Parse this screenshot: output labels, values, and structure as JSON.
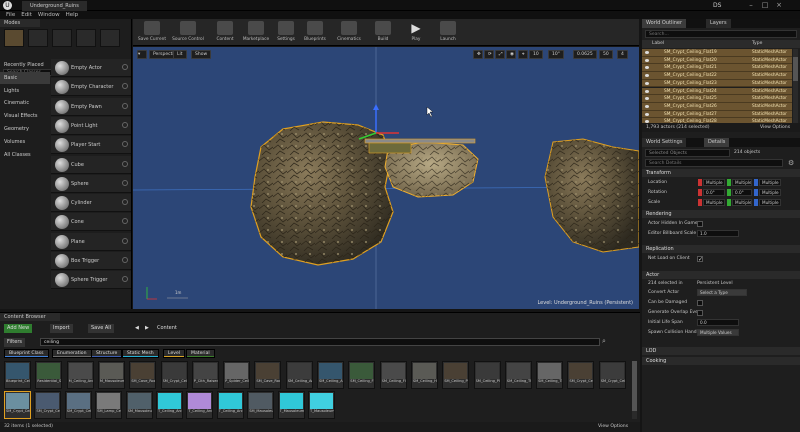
{
  "window": {
    "title": "Underground_Ruins",
    "user": "DS"
  },
  "menu": [
    "File",
    "Edit",
    "Window",
    "Help"
  ],
  "modes": {
    "tab": "Modes",
    "search_placeholder": "Search Classes",
    "categories": [
      "Recently Placed",
      "Basic",
      "Lights",
      "Cinematic",
      "Visual Effects",
      "Geometry",
      "Volumes",
      "All Classes"
    ],
    "selected_category": "Basic",
    "items": [
      "Empty Actor",
      "Empty Character",
      "Empty Pawn",
      "Point Light",
      "Player Start",
      "Cube",
      "Sphere",
      "Cylinder",
      "Cone",
      "Plane",
      "Box Trigger",
      "Sphere Trigger"
    ]
  },
  "toolbar": [
    "Save Current",
    "Source Control",
    "Content",
    "Marketplace",
    "Settings",
    "Blueprints",
    "Cinematics",
    "Build",
    "Play",
    "Launch"
  ],
  "viewport": {
    "perspective": "Perspective",
    "lit": "Lit",
    "show": "Show",
    "snap_grid": "10",
    "snap_angle": "10°",
    "snap_scale": "0.0625",
    "camera_speed": "50",
    "layers": "4",
    "scale_label": "1m",
    "level_info": "Level:  Underground_Ruins (Persistent)"
  },
  "outliner": {
    "tabs": [
      "World Outliner",
      "Layers"
    ],
    "search_placeholder": "Search...",
    "col_label": "Label",
    "col_type": "Type",
    "rows": [
      {
        "name": "SM_Crypt_Ceiling_Flat19",
        "type": "StaticMeshActor"
      },
      {
        "name": "SM_Crypt_Ceiling_Flat20",
        "type": "StaticMeshActor"
      },
      {
        "name": "SM_Crypt_Ceiling_Flat21",
        "type": "StaticMeshActor"
      },
      {
        "name": "SM_Crypt_Ceiling_Flat22",
        "type": "StaticMeshActor"
      },
      {
        "name": "SM_Crypt_Ceiling_Flat23",
        "type": "StaticMeshActor"
      },
      {
        "name": "SM_Crypt_Ceiling_Flat24",
        "type": "StaticMeshActor"
      },
      {
        "name": "SM_Crypt_Ceiling_Flat25",
        "type": "StaticMeshActor"
      },
      {
        "name": "SM_Crypt_Ceiling_Flat26",
        "type": "StaticMeshActor"
      },
      {
        "name": "SM_Crypt_Ceiling_Flat27",
        "type": "StaticMeshActor"
      },
      {
        "name": "SM_Crypt_Ceiling_Flat28",
        "type": "StaticMeshActor"
      }
    ],
    "count": "1,793 actors (214 selected)",
    "view_options": "View Options"
  },
  "details": {
    "tabs": [
      "World Settings",
      "Details"
    ],
    "selected_objects": "Selected Objects",
    "object_count": "214 objects",
    "search_placeholder": "Search Details",
    "transform": {
      "title": "Transform",
      "location": "Location",
      "rotation": "Rotation",
      "scale": "Scale",
      "multiple": "Multiple",
      "zero": "0.0°"
    },
    "rendering": {
      "title": "Rendering",
      "hidden": "Actor Hidden In Game",
      "billboard": "Editor Billboard Scale",
      "billboard_value": "1.0"
    },
    "replication": {
      "title": "Replication",
      "net_load": "Net Load on Client"
    },
    "actor": {
      "title": "Actor",
      "selected_in": "214 selected in",
      "persistent": "Persistent Level",
      "convert": "Convert Actor",
      "convert_value": "Select a Type",
      "can_damage": "Can be Damaged",
      "overlap": "Generate Overlap Eve",
      "lifespan": "Initial Life Span",
      "lifespan_value": "0.0",
      "spawn": "Spawn Collision Hand",
      "spawn_value": "Multiple Values"
    },
    "lod": "LOD",
    "cooking": "Cooking"
  },
  "content": {
    "tab": "Content Browser",
    "add_new": "Add New",
    "import": "Import",
    "save_all": "Save All",
    "path": "Content",
    "filters": "Filters",
    "search_value": "ceiling",
    "filter_chips": [
      {
        "label": "Blueprint Class",
        "color": "#3f7fd8"
      },
      {
        "label": "Enumeration",
        "color": "#6b6b6b"
      },
      {
        "label": "Structure",
        "color": "#3d5fb0"
      },
      {
        "label": "Static Mesh",
        "color": "#26b0d4"
      },
      {
        "label": "Level",
        "color": "#d8a325"
      },
      {
        "label": "Material",
        "color": "#3a7d2a"
      }
    ],
    "assets_row1": [
      "Blueprint_Ceiling_Lines",
      "Residential_Spider_Ceiling",
      "M_Ceiling_Arch_Sub",
      "M_Mausoleum_Ceiling",
      "SM_Cave_Rock_Ceiling_Dim",
      "SM_Crypt_Ceiling_Blank",
      "P_Clth_Raised_Ceiling_Drip",
      "P_Spider_Ceiling_Drip",
      "SM_Cave_Rock_Ceiling_Wide",
      "SM_Ceiling_Arch_A",
      "SM_Ceiling_Arch_E",
      "SM_Ceiling_Flat",
      "SM_Ceiling_Flat_Half",
      "SM_Ceiling_Half",
      "SM_Ceiling_Plaza",
      "SM_Ceiling_Plaza_B",
      "SM_Ceiling_Third",
      "SM_Ceiling_Third_Reverse",
      "SM_Crypt_Ceiling",
      "SM_Crypt_Ceiling_Flat"
    ],
    "assets_row2": [
      "SM_Crypt_Ceiling_Flat_Half",
      "SM_Crypt_Ceiling_Half",
      "SM_Crypt_Ceiling_Half_Arch",
      "SM_Lamp_Ceiling_Iron",
      "SM_Mausoleum_Ceiling",
      "T_Ceiling_Arch_A_Albedo",
      "T_Ceiling_Arch_Emissive",
      "T_Ceiling_Arch_Normal",
      "SM_Mausoleum_Ceiling_A",
      "T_Mausoleum_Ceiling_A",
      "T_Mausoleum_Ceiling_N"
    ],
    "items_count": "32 items (1 selected)",
    "view_options": "View Options"
  }
}
